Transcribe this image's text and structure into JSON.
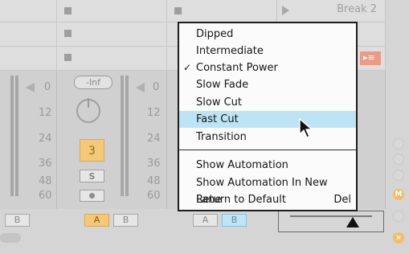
{
  "session_view": {
    "clip_name": "Break 2",
    "crossfade_switch_label": "▸≡"
  },
  "mixer": {
    "left_tick_labels": [
      "0",
      "12",
      "24",
      "36",
      "48",
      "60"
    ],
    "mid_tick_labels": [
      "0",
      "12",
      "24",
      "36",
      "48",
      "60"
    ],
    "right_tick_labels": [
      "0",
      "12",
      "24",
      "36",
      "48",
      "60"
    ],
    "volume_value": "-Inf",
    "track_number": "3",
    "solo_label": "S",
    "crossfade_assign": {
      "col1": [
        "B"
      ],
      "col2": [
        "A",
        "B"
      ],
      "col3": [
        "A",
        "B"
      ]
    }
  },
  "side_buttons": [
    "",
    "",
    "",
    "",
    "M",
    "",
    ""
  ],
  "context_menu": {
    "items": [
      {
        "label": "Dipped",
        "checked": false,
        "highlighted": false
      },
      {
        "label": "Intermediate",
        "checked": false,
        "highlighted": false
      },
      {
        "label": "Constant Power",
        "checked": true,
        "highlighted": false
      },
      {
        "label": "Slow Fade",
        "checked": false,
        "highlighted": false
      },
      {
        "label": "Slow Cut",
        "checked": false,
        "highlighted": false
      },
      {
        "label": "Fast Cut",
        "checked": false,
        "highlighted": true
      },
      {
        "label": "Transition",
        "checked": false,
        "highlighted": false
      }
    ],
    "automation_items": [
      {
        "label": "Show Automation",
        "shortcut": ""
      },
      {
        "label": "Show Automation In New Lane",
        "shortcut": ""
      },
      {
        "label": "Return to Default",
        "shortcut": "Del"
      }
    ],
    "check_glyph": "✓"
  },
  "colors": {
    "highlight": "#bde4f5",
    "track_active": "#f5c878",
    "crossfade_b_active": "#bfe3f7"
  }
}
